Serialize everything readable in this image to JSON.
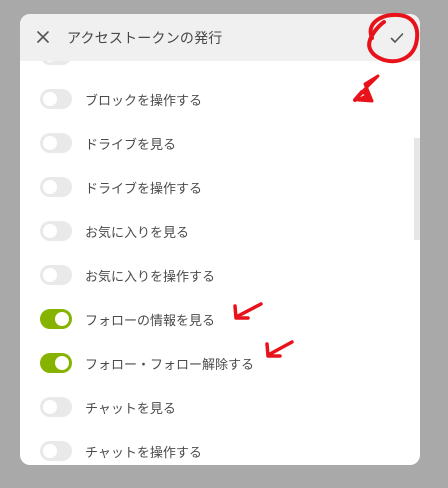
{
  "dialog": {
    "title": "アクセストークンの発行",
    "close_icon": "close-icon",
    "confirm_icon": "check-icon"
  },
  "permissions": [
    {
      "label": "",
      "enabled": false
    },
    {
      "label": "ブロックを操作する",
      "enabled": false
    },
    {
      "label": "ドライブを見る",
      "enabled": false
    },
    {
      "label": "ドライブを操作する",
      "enabled": false
    },
    {
      "label": "お気に入りを見る",
      "enabled": false
    },
    {
      "label": "お気に入りを操作する",
      "enabled": false
    },
    {
      "label": "フォローの情報を見る",
      "enabled": true
    },
    {
      "label": "フォロー・フォロー解除する",
      "enabled": true
    },
    {
      "label": "チャットを見る",
      "enabled": false
    },
    {
      "label": "チャットを操作する",
      "enabled": false
    }
  ],
  "colors": {
    "toggle_on": "#86b300",
    "toggle_off": "#e9e9e9",
    "annotation": "#e8121a"
  }
}
